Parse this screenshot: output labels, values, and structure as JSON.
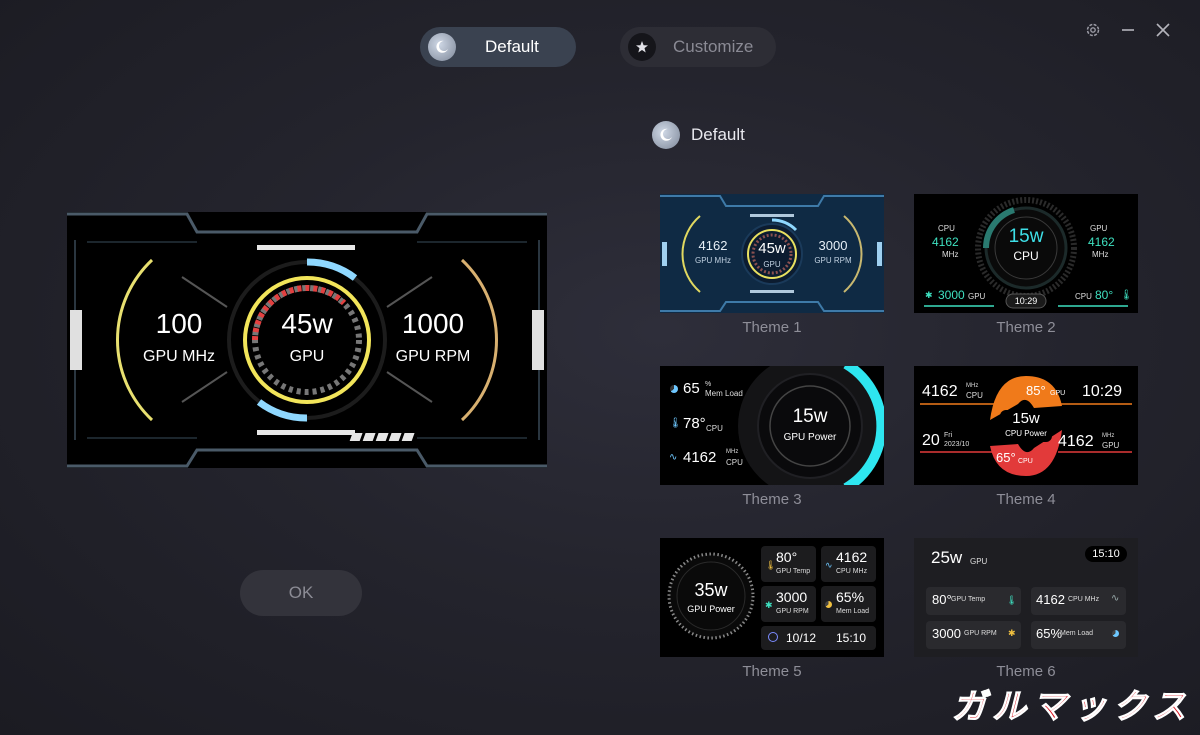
{
  "tabs": {
    "default_label": "Default",
    "customize_label": "Customize"
  },
  "preview": {
    "left_value": "100",
    "left_label": "GPU MHz",
    "center_value": "45w",
    "center_label": "GPU",
    "right_value": "1000",
    "right_label": "GPU RPM"
  },
  "ok_label": "OK",
  "section": {
    "label": "Default"
  },
  "themes": [
    {
      "caption": "Theme 1",
      "l_val": "4162",
      "l_lbl": "GPU MHz",
      "c_val": "45w",
      "c_lbl": "GPU",
      "r_val": "3000",
      "r_lbl": "GPU RPM"
    },
    {
      "caption": "Theme 2",
      "cpu_lbl": "CPU",
      "cpu_val": "4162",
      "cpu_unit": "MHz",
      "gpu_lbl": "GPU",
      "gpu_val": "4162",
      "gpu_unit": "MHz",
      "c_val": "15w",
      "c_lbl": "CPU",
      "time": "10:29",
      "rpm_val": "3000",
      "rpm_lbl": "GPU",
      "temp_lbl": "CPU",
      "temp_val": "80°"
    },
    {
      "caption": "Theme 3",
      "load_val": "65",
      "load_unit": "%",
      "load_lbl": "Mem Load",
      "temp_val": "78°",
      "temp_lbl": "CPU",
      "mhz_val": "4162",
      "mhz_unit": "MHz",
      "mhz_lbl": "CPU",
      "c_val": "15w",
      "c_lbl": "GPU Power"
    },
    {
      "caption": "Theme 4",
      "mhz_val": "4162",
      "mhz_unit": "MHz",
      "mhz_lbl": "CPU",
      "top_val": "85°",
      "top_lbl": "GPU",
      "time": "10:29",
      "c_val": "15w",
      "c_lbl": "CPU Power",
      "day": "20",
      "weekday": "Fri",
      "month": "2023/10",
      "bot_val": "65°",
      "bot_lbl": "CPU",
      "gmhz_val": "4162",
      "gmhz_unit": "MHz",
      "gmhz_lbl": "GPU"
    },
    {
      "caption": "Theme 5",
      "c_val": "35w",
      "c_lbl": "GPU Power",
      "temp_val": "80°",
      "temp_lbl": "GPU Temp",
      "mhz_val": "4162",
      "mhz_lbl": "CPU MHz",
      "rpm_val": "3000",
      "rpm_lbl": "GPU RPM",
      "load_val": "65%",
      "load_lbl": "Mem Load",
      "date": "10/12",
      "time": "15:10"
    },
    {
      "caption": "Theme 6",
      "power_val": "25w",
      "power_lbl": "GPU",
      "time": "15:10",
      "temp_val": "80°",
      "temp_lbl": "GPU Temp",
      "mhz_val": "4162",
      "mhz_lbl": "CPU MHz",
      "rpm_val": "3000",
      "rpm_lbl": "GPU RPM",
      "load_val": "65%",
      "load_lbl": "Mem Load"
    }
  ],
  "watermark": "ガルマックス",
  "colors": {
    "accent_blue": "#7fd4ff",
    "accent_yellow": "#f2e55a",
    "accent_red": "#e24040",
    "accent_orange": "#f07a1a",
    "accent_cyan": "#2ee6f0",
    "accent_green": "#3ee0c0"
  }
}
